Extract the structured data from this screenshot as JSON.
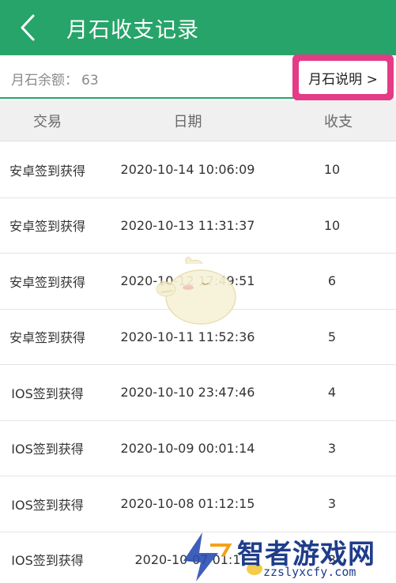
{
  "header": {
    "title": "月石收支记录",
    "back_icon": "chevron-left-icon",
    "background_color": "#27a46a"
  },
  "balance": {
    "label": "月石余额：",
    "value": "63"
  },
  "explain_button": {
    "label": "月石说明 >",
    "highlight_color": "#e43b86"
  },
  "table": {
    "columns": [
      "交易",
      "日期",
      "收支"
    ],
    "rows": [
      {
        "type": "安卓签到获得",
        "date": "2020-10-14 10:06:09",
        "amount": "10"
      },
      {
        "type": "安卓签到获得",
        "date": "2020-10-13 11:31:37",
        "amount": "10"
      },
      {
        "type": "安卓签到获得",
        "date": "2020-10-12 17:49:51",
        "amount": "6"
      },
      {
        "type": "安卓签到获得",
        "date": "2020-10-11 11:52:36",
        "amount": "5"
      },
      {
        "type": "IOS签到获得",
        "date": "2020-10-10 23:47:46",
        "amount": "4"
      },
      {
        "type": "IOS签到获得",
        "date": "2020-10-09 00:01:14",
        "amount": "3"
      },
      {
        "type": "IOS签到获得",
        "date": "2020-10-08 01:12:15",
        "amount": "3"
      },
      {
        "type": "IOS签到获得",
        "date": "2020-10-07 01:1",
        "amount": "3"
      }
    ]
  },
  "watermark": {
    "title": "智者游戏网",
    "url": "zzslyxcfy.com"
  }
}
